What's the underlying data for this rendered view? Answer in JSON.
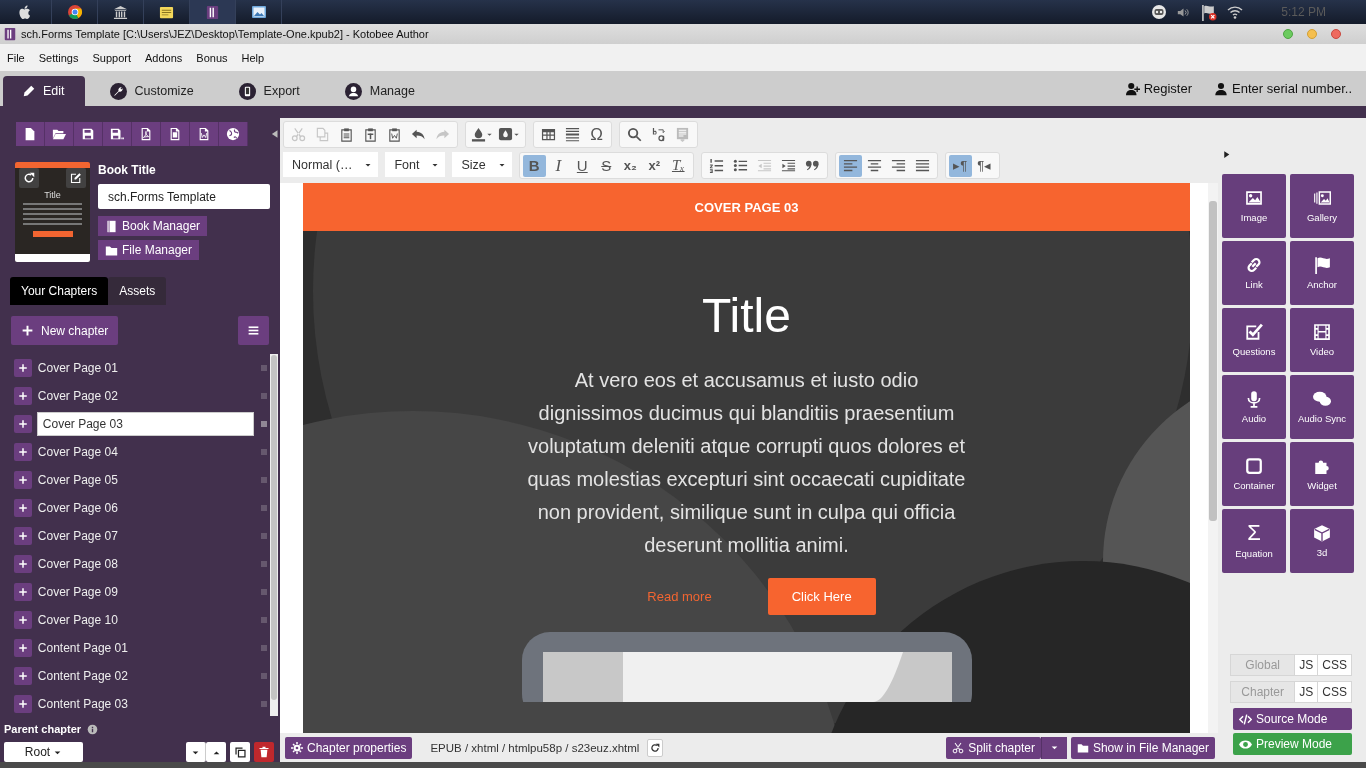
{
  "taskbar": {
    "clock": "5:12 PM"
  },
  "window": {
    "title": "sch.Forms Template [C:\\Users\\JEZ\\Desktop\\Template-One.kpub2] - Kotobee Author"
  },
  "menu": [
    "File",
    "Settings",
    "Support",
    "Addons",
    "Bonus",
    "Help"
  ],
  "tabs": [
    {
      "label": "Edit",
      "kind": "edit",
      "selected": true
    },
    {
      "label": "Customize",
      "kind": "customize",
      "selected": false
    },
    {
      "label": "Export",
      "kind": "export",
      "selected": false
    },
    {
      "label": "Manage",
      "kind": "manage",
      "selected": false
    }
  ],
  "account": [
    {
      "label": "Register",
      "kind": "register"
    },
    {
      "label": "Enter serial number..",
      "kind": "serial"
    }
  ],
  "file_toolbar": [
    {
      "kind": "new"
    },
    {
      "kind": "open"
    },
    {
      "kind": "save"
    },
    {
      "kind": "save_as"
    },
    {
      "kind": "pdf"
    },
    {
      "kind": "print"
    },
    {
      "kind": "word"
    },
    {
      "kind": "web"
    }
  ],
  "book": {
    "label": "Book Title",
    "title": "sch.Forms Template",
    "cover_title": "Title",
    "buttons": [
      {
        "label": "Book Manager",
        "kind": "book"
      },
      {
        "label": "File Manager",
        "kind": "folder"
      }
    ]
  },
  "sidebar_tabs": [
    {
      "label": "Your Chapters",
      "selected": true
    },
    {
      "label": "Assets",
      "selected": false
    }
  ],
  "new_chapter": "New chapter",
  "chapters": [
    {
      "label": "Cover Page 01",
      "selected": false
    },
    {
      "label": "Cover Page 02",
      "selected": false
    },
    {
      "label": "Cover Page 03",
      "selected": true
    },
    {
      "label": "Cover Page 04",
      "selected": false
    },
    {
      "label": "Cover Page 05",
      "selected": false
    },
    {
      "label": "Cover Page 06",
      "selected": false
    },
    {
      "label": "Cover Page 07",
      "selected": false
    },
    {
      "label": "Cover Page 08",
      "selected": false
    },
    {
      "label": "Cover Page 09",
      "selected": false
    },
    {
      "label": "Cover Page 10",
      "selected": false
    },
    {
      "label": "Content Page 01",
      "selected": false
    },
    {
      "label": "Content Page 02",
      "selected": false
    },
    {
      "label": "Content Page 03",
      "selected": false
    }
  ],
  "parent_chapter": {
    "label": "Parent chapter",
    "value": "Root"
  },
  "toolbar_rows": [
    [
      [
        {
          "kind": "cut",
          "disabled": true
        },
        {
          "kind": "copy",
          "disabled": true
        },
        {
          "kind": "paste",
          "disabled": false
        },
        {
          "kind": "paste_text",
          "disabled": false
        },
        {
          "kind": "paste_word",
          "disabled": false
        },
        {
          "kind": "undo",
          "disabled": false
        },
        {
          "kind": "redo",
          "disabled": true
        }
      ],
      [
        {
          "kind": "text_color",
          "disabled": false
        },
        {
          "kind": "bg_color",
          "disabled": false
        }
      ],
      [
        {
          "kind": "table",
          "disabled": false
        },
        {
          "kind": "hr",
          "disabled": false
        },
        {
          "kind": "special_char",
          "glyph": "Ω",
          "disabled": false
        }
      ],
      [
        {
          "kind": "find",
          "disabled": false
        },
        {
          "kind": "replace",
          "disabled": false
        },
        {
          "kind": "template",
          "disabled": true
        }
      ]
    ],
    [
      [
        {
          "kind": "dropdown",
          "label": "Normal (…"
        }
      ],
      [
        {
          "kind": "dropdown",
          "label": "Font"
        }
      ],
      [
        {
          "kind": "dropdown",
          "label": "Size"
        }
      ],
      [
        {
          "kind": "bold",
          "glyph": "B",
          "active": true
        },
        {
          "kind": "italic",
          "glyph": "I",
          "active": false
        },
        {
          "kind": "underline",
          "glyph": "U",
          "active": false
        },
        {
          "kind": "strike",
          "glyph": "S",
          "active": false
        },
        {
          "kind": "subscript",
          "glyph": "x₂",
          "active": false
        },
        {
          "kind": "superscript",
          "glyph": "x²",
          "active": false
        },
        {
          "kind": "clear",
          "glyph": "Tₓ",
          "active": false
        }
      ],
      [
        {
          "kind": "ol",
          "disabled": false
        },
        {
          "kind": "ul",
          "disabled": false
        },
        {
          "kind": "outdent",
          "disabled": true
        },
        {
          "kind": "indent",
          "disabled": false
        },
        {
          "kind": "quote",
          "disabled": false
        }
      ],
      [
        {
          "kind": "align_left",
          "active": true
        },
        {
          "kind": "align_center",
          "active": false
        },
        {
          "kind": "align_right",
          "active": false
        },
        {
          "kind": "align_justify",
          "active": false
        }
      ],
      [
        {
          "kind": "ltr",
          "glyph": "▸¶",
          "active": true
        },
        {
          "kind": "rtl",
          "glyph": "¶◂",
          "active": false
        }
      ]
    ]
  ],
  "page": {
    "header": "COVER PAGE 03",
    "title": "Title",
    "body": "At vero eos et accusamus et iusto odio dignissimos ducimus qui blanditiis praesentium voluptatum deleniti atque corrupti quos dolores et quas molestias excepturi sint occaecati cupiditate non provident, similique sunt in culpa qui officia deserunt mollitia animi.",
    "link": "Read more",
    "button": "Click Here"
  },
  "status": {
    "properties": "Chapter properties",
    "path": "EPUB / xhtml / htmlpu58p / s23euz.xhtml",
    "split": "Split chapter",
    "show": "Show in File Manager"
  },
  "widgets": [
    {
      "label": "Image",
      "kind": "image"
    },
    {
      "label": "Gallery",
      "kind": "gallery"
    },
    {
      "label": "Link",
      "kind": "link"
    },
    {
      "label": "Anchor",
      "kind": "anchor"
    },
    {
      "label": "Questions",
      "kind": "questions"
    },
    {
      "label": "Video",
      "kind": "video"
    },
    {
      "label": "Audio",
      "kind": "audio"
    },
    {
      "label": "Audio Sync",
      "kind": "audio_sync"
    },
    {
      "label": "Container",
      "kind": "container"
    },
    {
      "label": "Widget",
      "kind": "widget"
    },
    {
      "label": "Equation",
      "kind": "equation",
      "glyph": "Σ"
    },
    {
      "label": "3d",
      "kind": "cube"
    }
  ],
  "code_rows": [
    {
      "label": "Global",
      "buttons": [
        "JS",
        "CSS"
      ]
    },
    {
      "label": "Chapter",
      "buttons": [
        "JS",
        "CSS"
      ]
    }
  ],
  "modes": [
    {
      "label": "Source Mode",
      "kind": "source"
    },
    {
      "label": "Preview Mode",
      "kind": "preview"
    }
  ]
}
